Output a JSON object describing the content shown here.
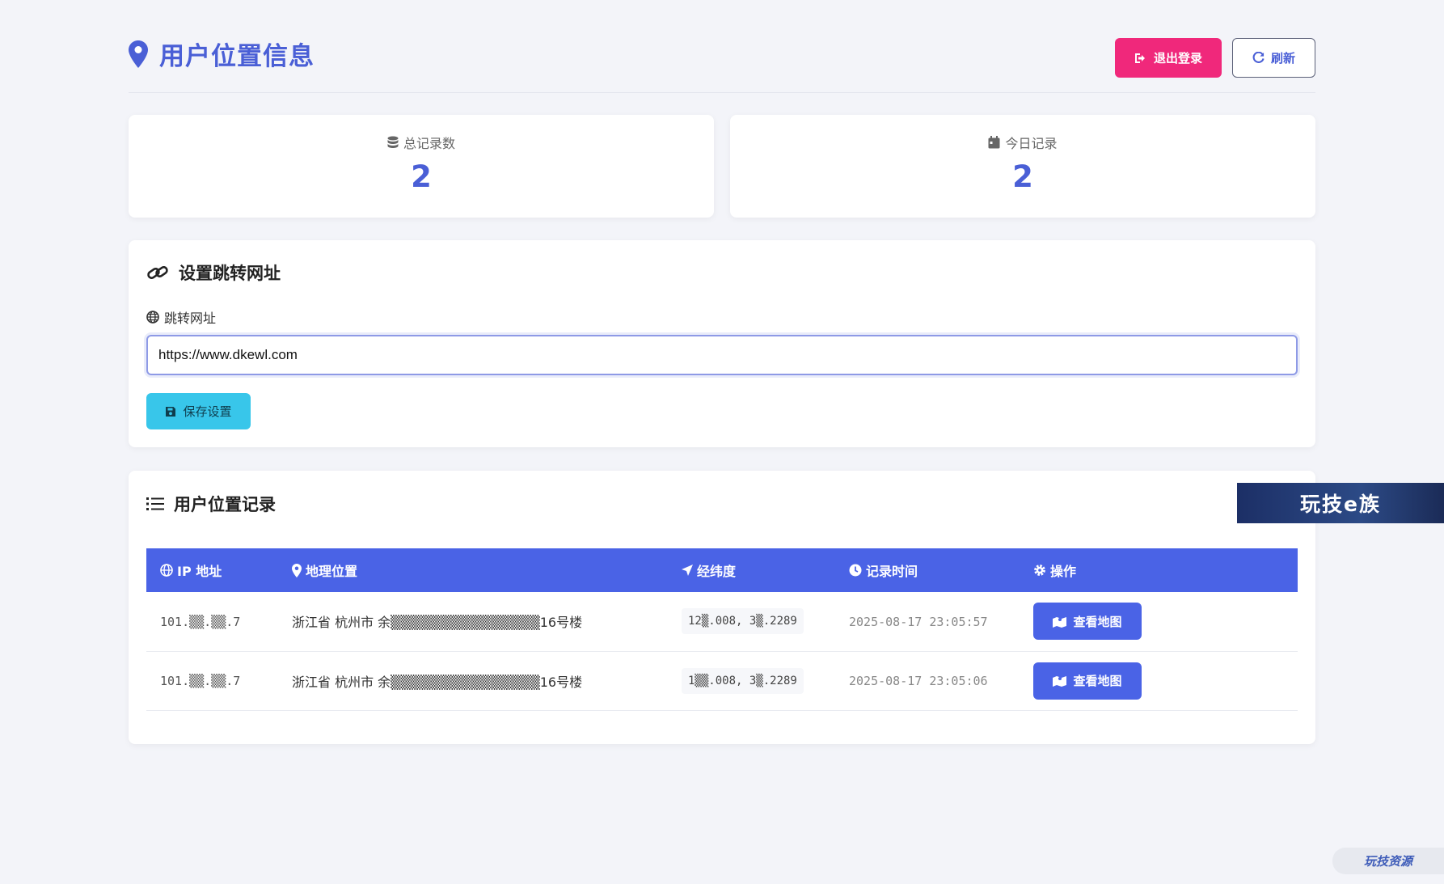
{
  "header": {
    "title": "用户位置信息",
    "logout_label": "退出登录",
    "refresh_label": "刷新"
  },
  "stats": [
    {
      "label": "总记录数",
      "value": "2"
    },
    {
      "label": "今日记录",
      "value": "2"
    }
  ],
  "settings": {
    "title": "设置跳转网址",
    "field_label": "跳转网址",
    "url_value": "https://www.dkewl.com",
    "save_label": "保存设置"
  },
  "records": {
    "title": "用户位置记录",
    "columns": [
      "IP 地址",
      "地理位置",
      "经纬度",
      "记录时间",
      "操作"
    ],
    "rows": [
      {
        "ip": "101.▒▒.▒▒.7",
        "location": "浙江省 杭州市 余▒▒▒▒▒▒▒▒▒▒▒▒▒▒▒16号楼",
        "coords": "12▒.008, 3▒.2289",
        "time": "2025-08-17 23:05:57",
        "action": "查看地图"
      },
      {
        "ip": "101.▒▒.▒▒.7",
        "location": "浙江省 杭州市 余▒▒▒▒▒▒▒▒▒▒▒▒▒▒▒16号楼",
        "coords": "1▒▒.008, 3▒.2289",
        "time": "2025-08-17 23:05:06",
        "action": "查看地图"
      }
    ]
  },
  "watermarks": {
    "banner": "玩技e族",
    "corner": "玩技资源"
  },
  "colors": {
    "primary": "#4a63e6",
    "danger": "#f0287b",
    "info": "#38c6ea",
    "background": "#f3f4f9"
  }
}
